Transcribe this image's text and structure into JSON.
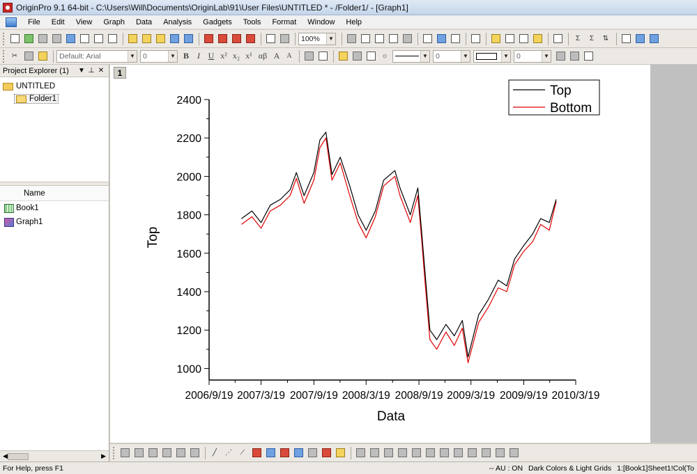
{
  "window": {
    "title": "OriginPro 9.1 64-bit - C:\\Users\\Will\\Documents\\OriginLab\\91\\User Files\\UNTITLED * - /Folder1/ - [Graph1]"
  },
  "menu": [
    "File",
    "Edit",
    "View",
    "Graph",
    "Data",
    "Analysis",
    "Gadgets",
    "Tools",
    "Format",
    "Window",
    "Help"
  ],
  "toolbar": {
    "zoom": "100%",
    "font": "Default: Arial",
    "font_size": "0",
    "line_width": "0",
    "pattern_size": "0",
    "format_buttons": [
      "B",
      "I",
      "U",
      "x²",
      "x₂",
      "x¹",
      "αβ",
      "A",
      "A"
    ]
  },
  "explorer": {
    "title": "Project Explorer (1)",
    "root": "UNTITLED",
    "folder": "Folder1",
    "list_header": "Name",
    "items": [
      {
        "name": "Book1",
        "icon": "workbook-icon"
      },
      {
        "name": "Graph1",
        "icon": "graph-icon"
      }
    ]
  },
  "graph": {
    "layer": "1"
  },
  "chart_data": {
    "type": "line",
    "xlabel": "Data",
    "ylabel": "Top",
    "x_ticks": [
      "2006/9/19",
      "2007/3/19",
      "2007/9/19",
      "2008/3/19",
      "2008/9/19",
      "2009/3/19",
      "2009/9/19",
      "2010/3/19"
    ],
    "y_ticks": [
      1000,
      1200,
      1400,
      1600,
      1800,
      2000,
      2200,
      2400
    ],
    "ylim": [
      940,
      2400
    ],
    "xlim": [
      "2006/9/19",
      "2010/3/19"
    ],
    "legend_position": "top-right",
    "series": [
      {
        "name": "Top",
        "color": "#000000",
        "x": [
          "2007/1/10",
          "2007/2/15",
          "2007/3/19",
          "2007/4/20",
          "2007/5/25",
          "2007/6/28",
          "2007/7/20",
          "2007/8/16",
          "2007/9/19",
          "2007/10/10",
          "2007/10/31",
          "2007/11/21",
          "2007/12/20",
          "2008/1/22",
          "2008/2/20",
          "2008/3/19",
          "2008/4/20",
          "2008/5/19",
          "2008/6/27",
          "2008/7/15",
          "2008/8/20",
          "2008/9/15",
          "2008/9/29",
          "2008/10/10",
          "2008/10/27",
          "2008/11/20",
          "2008/12/22",
          "2009/1/20",
          "2009/2/17",
          "2009/3/9",
          "2009/4/15",
          "2009/5/19",
          "2009/6/22",
          "2009/7/22",
          "2009/8/18",
          "2009/9/19",
          "2009/10/20",
          "2009/11/17",
          "2009/12/17",
          "2010/1/10"
        ],
        "values": [
          1780,
          1820,
          1760,
          1850,
          1880,
          1930,
          2020,
          1900,
          2020,
          2190,
          2230,
          2010,
          2100,
          1950,
          1800,
          1720,
          1820,
          1980,
          2030,
          1940,
          1800,
          1940,
          1700,
          1500,
          1200,
          1150,
          1230,
          1170,
          1250,
          1060,
          1280,
          1360,
          1460,
          1430,
          1570,
          1640,
          1700,
          1780,
          1760,
          1880
        ]
      },
      {
        "name": "Bottom",
        "color": "#e00000",
        "x": [
          "2007/1/10",
          "2007/2/15",
          "2007/3/19",
          "2007/4/20",
          "2007/5/25",
          "2007/6/28",
          "2007/7/20",
          "2007/8/16",
          "2007/9/19",
          "2007/10/10",
          "2007/10/31",
          "2007/11/21",
          "2007/12/20",
          "2008/1/22",
          "2008/2/20",
          "2008/3/19",
          "2008/4/20",
          "2008/5/19",
          "2008/6/27",
          "2008/7/15",
          "2008/8/20",
          "2008/9/15",
          "2008/9/29",
          "2008/10/10",
          "2008/10/27",
          "2008/11/20",
          "2008/12/22",
          "2009/1/20",
          "2009/2/17",
          "2009/3/9",
          "2009/4/15",
          "2009/5/19",
          "2009/6/22",
          "2009/7/22",
          "2009/8/18",
          "2009/9/19",
          "2009/10/20",
          "2009/11/17",
          "2009/12/17",
          "2010/1/10"
        ],
        "values": [
          1750,
          1790,
          1730,
          1820,
          1850,
          1900,
          1990,
          1860,
          1980,
          2150,
          2200,
          1980,
          2070,
          1900,
          1760,
          1680,
          1790,
          1950,
          2000,
          1900,
          1760,
          1900,
          1660,
          1450,
          1150,
          1100,
          1190,
          1120,
          1210,
          1030,
          1240,
          1320,
          1420,
          1400,
          1540,
          1610,
          1660,
          1750,
          1720,
          1870
        ]
      }
    ]
  },
  "status": {
    "help": "For Help, press F1",
    "au": "-- AU : ON",
    "theme": "Dark Colors & Light Grids",
    "selection": "1:[Book1]Sheet1!Col(To"
  }
}
